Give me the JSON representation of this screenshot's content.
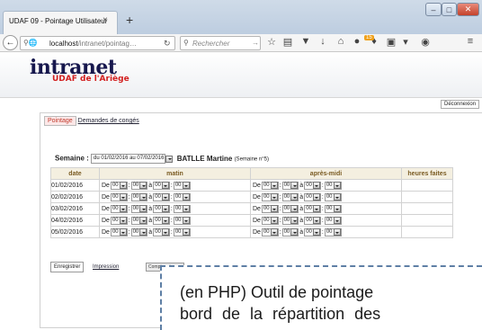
{
  "browser": {
    "tab_title": "UDAF 09 - Pointage Utilisateur",
    "tab_close": "×",
    "new_tab": "+",
    "url_host": "localhost",
    "url_path": "/intranet/pointag…",
    "search_placeholder": "Rechercher",
    "win_min": "–",
    "win_max": "□",
    "win_close": "✕",
    "badge": "15"
  },
  "header": {
    "logo": "intranet",
    "subtitle": "UDAF de l'Ariège"
  },
  "logout_label": "Déconnexion",
  "tabs": {
    "pointage": "Pointage",
    "conges": "Demandes de congés"
  },
  "semaine": {
    "label": "Semaine :",
    "selected": "du 01/02/2016 au 07/02/2016",
    "user": "BATLLE Martine",
    "note": "(Semaine n°5)"
  },
  "table": {
    "headers": {
      "date": "date",
      "matin": "matin",
      "apres_midi": "après-midi",
      "heures": "heures faites"
    },
    "de": "De",
    "a": "à",
    "sep": ":",
    "time": "00",
    "rows": [
      {
        "date": "01/02/2016"
      },
      {
        "date": "02/02/2016"
      },
      {
        "date": "03/02/2016"
      },
      {
        "date": "04/02/2016"
      },
      {
        "date": "05/02/2016"
      }
    ]
  },
  "actions": {
    "save": "Enregistrer",
    "print": "Impression",
    "counter": "Compteur temps"
  },
  "caption": {
    "line1": "(en PHP) Outil de pointage",
    "line2": "bord de la répartition des"
  }
}
